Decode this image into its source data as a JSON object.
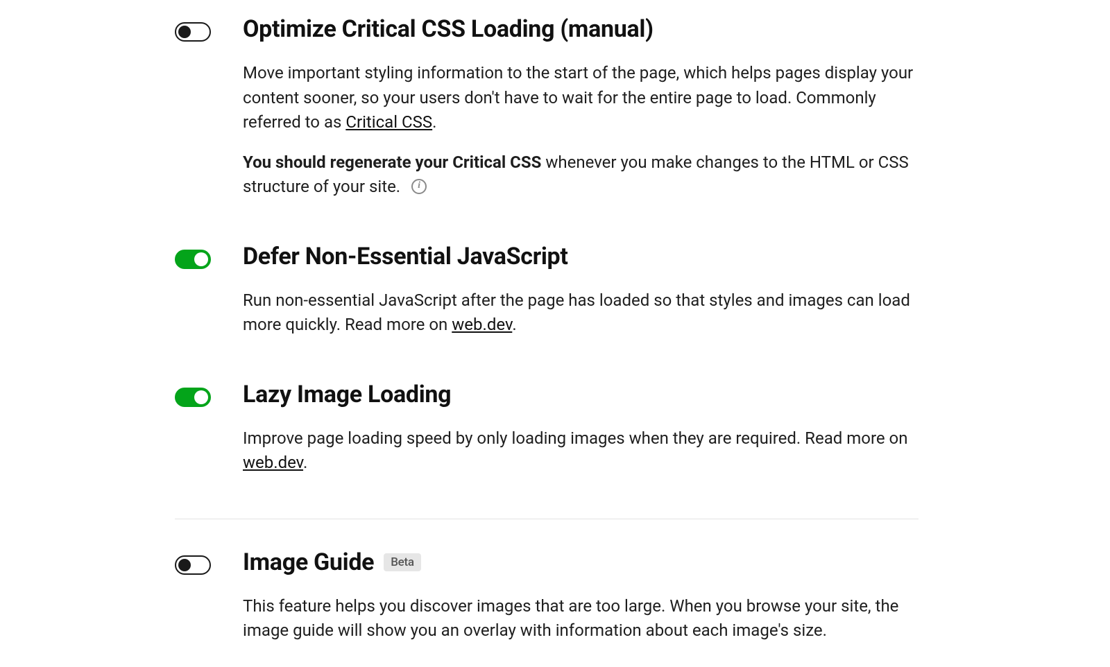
{
  "settings": [
    {
      "key": "critical-css",
      "title": "Optimize Critical CSS Loading (manual)",
      "enabled": false,
      "desc1_pre": "Move important styling information to the start of the page, which helps pages display your content sooner, so your users don't have to wait for the entire page to load. Commonly referred to as ",
      "desc1_link": "Critical CSS",
      "desc1_post": ".",
      "desc2_strong": "You should regenerate your Critical CSS",
      "desc2_rest": " whenever you make changes to the HTML or CSS structure of your site."
    },
    {
      "key": "defer-js",
      "title": "Defer Non-Essential JavaScript",
      "enabled": true,
      "desc1_pre": "Run non-essential JavaScript after the page has loaded so that styles and images can load more quickly. Read more on ",
      "desc1_link": "web.dev",
      "desc1_post": "."
    },
    {
      "key": "lazy-images",
      "title": "Lazy Image Loading",
      "enabled": true,
      "desc1_pre": "Improve page loading speed by only loading images when they are required. Read more on ",
      "desc1_link": "web.dev",
      "desc1_post": "."
    },
    {
      "key": "image-guide",
      "title": "Image Guide",
      "badge": "Beta",
      "enabled": false,
      "desc1_pre": "This feature helps you discover images that are too large. When you browse your site, the image guide will show you an overlay with information about each image's size.",
      "desc1_link": "",
      "desc1_post": ""
    }
  ]
}
